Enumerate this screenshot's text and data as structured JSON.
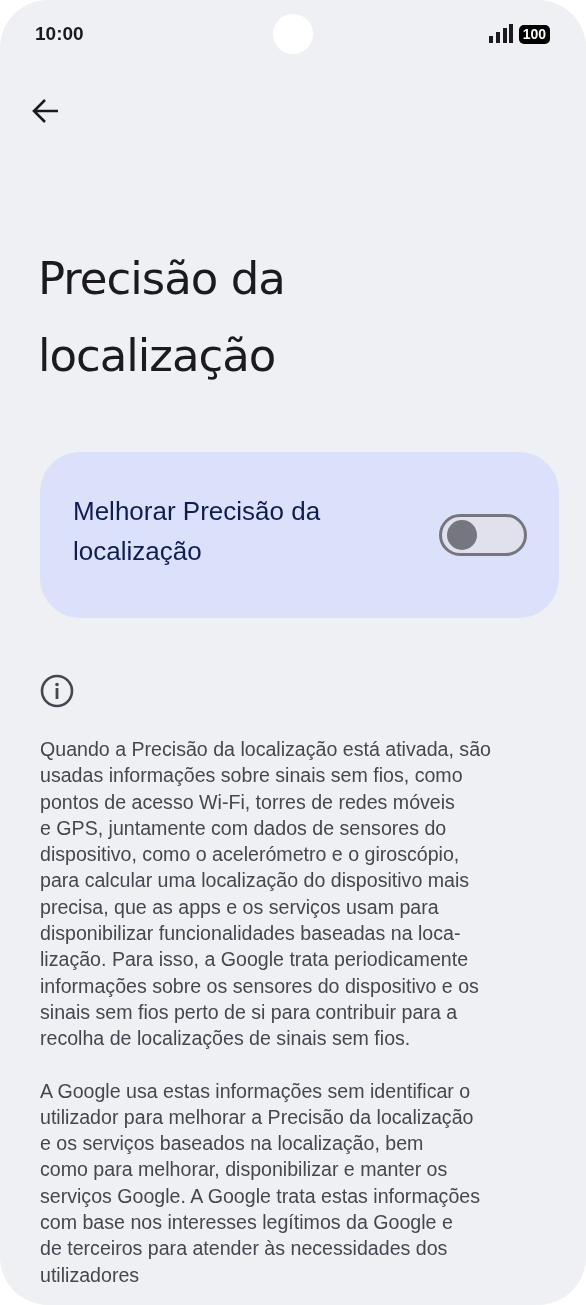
{
  "status_bar": {
    "time": "10:00",
    "battery": "100"
  },
  "title": "Precisão da localização",
  "setting": {
    "label": "Melhorar Precisão da localização",
    "on": false
  },
  "paragraphs": [
    "Quando a Precisão da localização está ativada, são\nusadas informações sobre sinais sem fios, como\npontos de acesso Wi-Fi, torres de redes móveis\ne GPS, juntamente com dados de sensores do\ndispositivo, como o acelerómetro e o giroscópio,\npara calcular uma localização do dispositivo mais\nprecisa, que as apps e os serviços usam para\ndisponibilizar funcionalidades baseadas na loca-\nlização. Para isso, a Google trata periodicamente\ninformações sobre os sensores do dispositivo e os\nsinais sem fios perto de si para contribuir para a\nrecolha de localizações de sinais sem fios.",
    "A Google usa estas informações sem identificar o\nutilizador para melhorar a Precisão da localização\ne os serviços baseados na localização, bem\ncomo para melhorar, disponibilizar e manter os\nserviços Google. A Google trata estas informações\ncom base nos interesses legítimos da Google e\nde terceiros para atender às necessidades dos\nutilizadores"
  ]
}
